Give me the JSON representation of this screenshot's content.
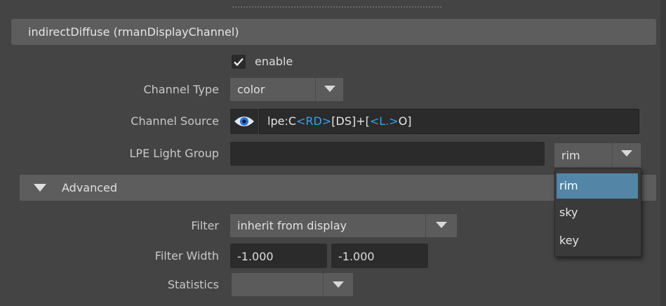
{
  "panel": {
    "title": "indirectDiffuse (rmanDisplayChannel)"
  },
  "enable": {
    "label": "enable",
    "checked": true
  },
  "channel_type": {
    "label": "Channel Type",
    "value": "color"
  },
  "channel_source": {
    "label": "Channel Source",
    "parts": [
      "lpe:C",
      "<RD>",
      "[DS]+[",
      "<L.>",
      "O]"
    ]
  },
  "lpe_light_group": {
    "label": "LPE Light Group",
    "value": "",
    "selected": "rim",
    "options": [
      "rim",
      "sky",
      "key"
    ]
  },
  "advanced": {
    "title": "Advanced",
    "filter": {
      "label": "Filter",
      "value": "inherit from display"
    },
    "filter_width": {
      "label": "Filter Width",
      "x": "-1.000",
      "y": "-1.000"
    },
    "statistics": {
      "label": "Statistics",
      "value": ""
    }
  },
  "colors": {
    "background": "#444444",
    "header": "#5d5d5d",
    "field": "#2b2b2b",
    "accent_token": "#3da0e6",
    "selection": "#5285a6"
  }
}
